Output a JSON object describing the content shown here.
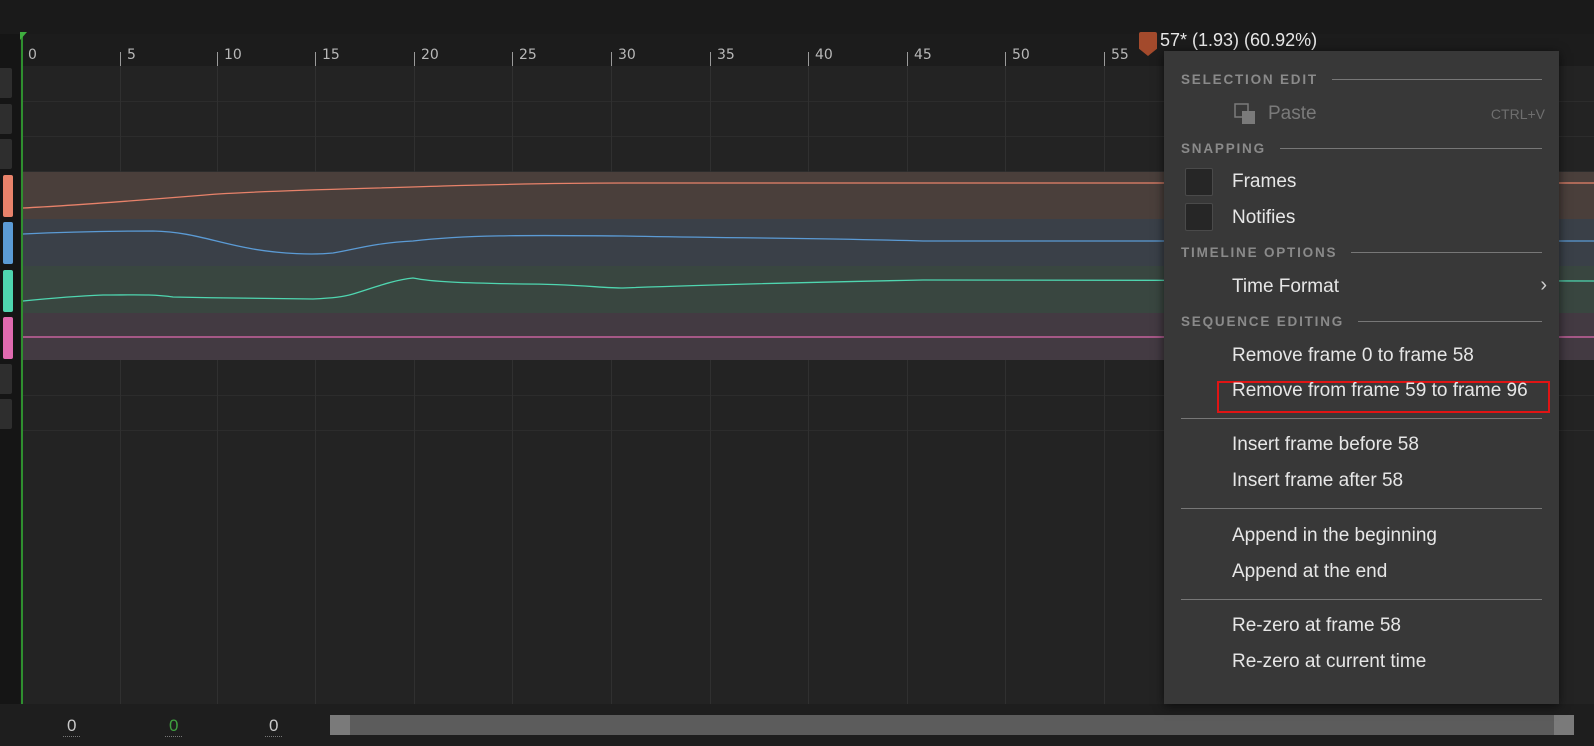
{
  "timeline": {
    "ruler_ticks": [
      "0",
      "5",
      "10",
      "15",
      "20",
      "25",
      "30",
      "35",
      "40",
      "45",
      "50",
      "55"
    ],
    "playhead_label": "57* (1.93) (60.92%)",
    "curve_colors": {
      "orange": "#e8826a",
      "blue": "#5b9bd5",
      "teal": "#4fd6b0",
      "pink": "#e06ab0"
    }
  },
  "bottom": {
    "value1": "0",
    "value2": "0",
    "value3": "0",
    "value2_color": "#3f9f3f"
  },
  "context_menu": {
    "selection_edit_header": "SELECTION EDIT",
    "paste_label": "Paste",
    "paste_shortcut": "CTRL+V",
    "snapping_header": "SNAPPING",
    "frames_label": "Frames",
    "notifies_label": "Notifies",
    "timeline_options_header": "TIMELINE OPTIONS",
    "time_format_label": "Time Format",
    "sequence_editing_header": "SEQUENCE EDITING",
    "remove_before_label": "Remove frame 0 to frame 58",
    "remove_after_label": "Remove from frame 59 to frame 96",
    "insert_before_label": "Insert frame before 58",
    "insert_after_label": "Insert frame after 58",
    "append_beginning_label": "Append in the beginning",
    "append_end_label": "Append at the end",
    "rezero_frame_label": "Re-zero at frame 58",
    "rezero_current_label": "Re-zero at current time"
  }
}
